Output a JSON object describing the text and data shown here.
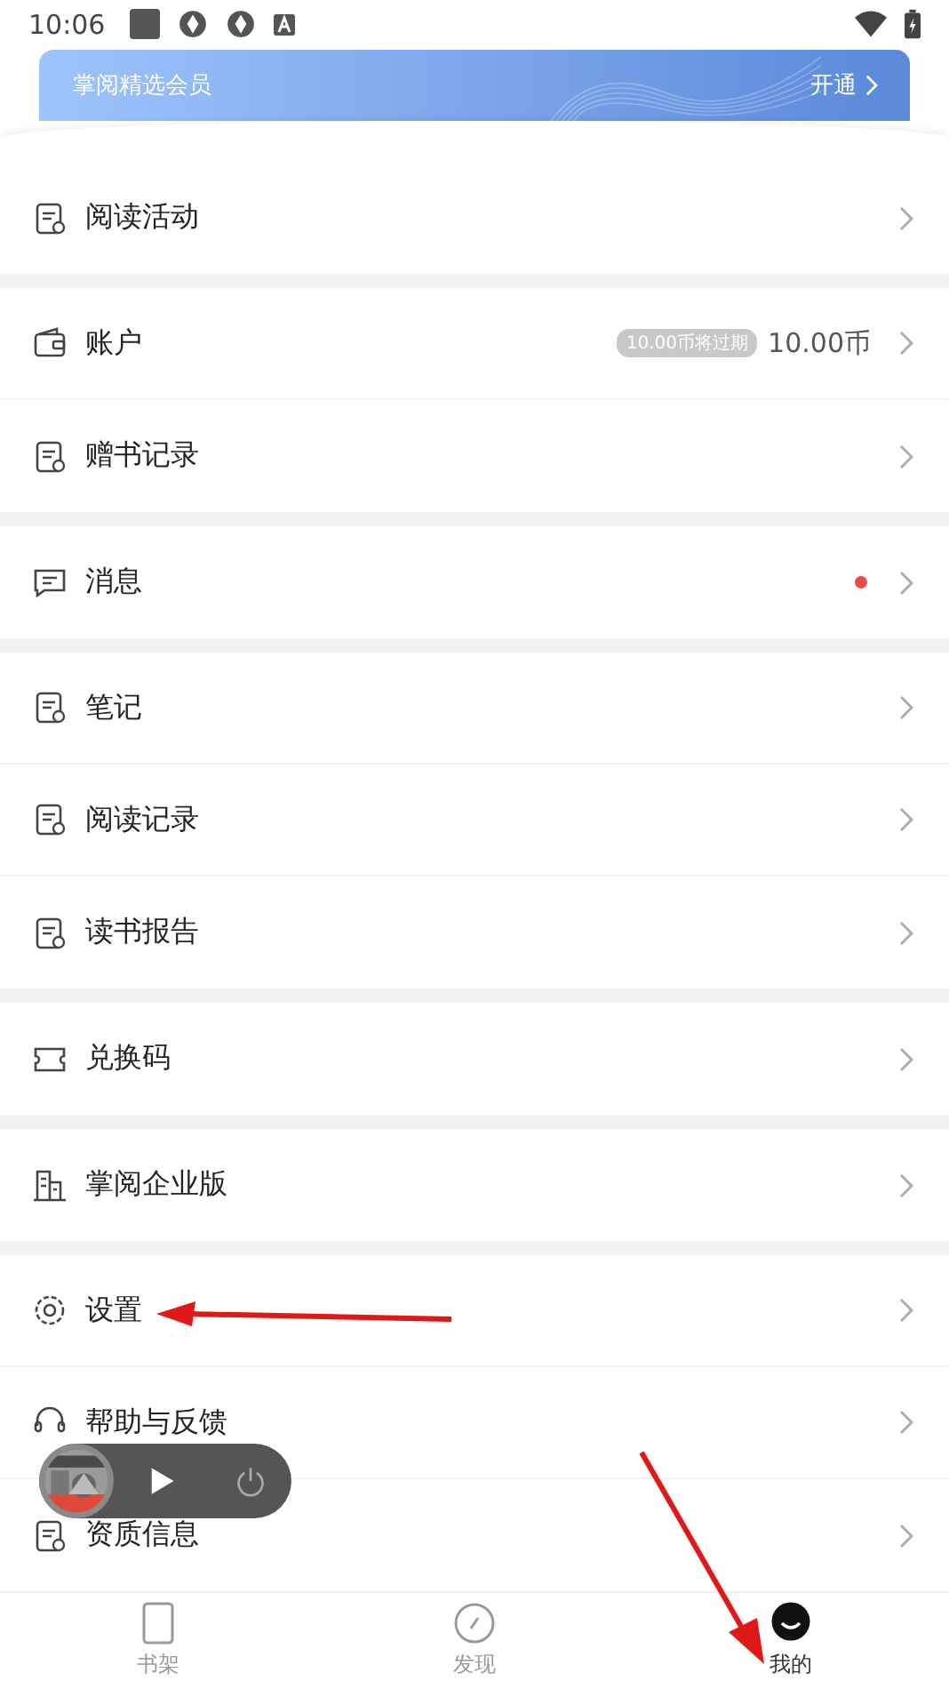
{
  "status_bar": {
    "time": "10:06"
  },
  "vip_banner": {
    "title": "掌阅精选会员",
    "action": "开通"
  },
  "sections": [
    {
      "items": [
        {
          "label": "阅读活动"
        }
      ]
    },
    {
      "items": [
        {
          "label": "账户",
          "badge": "10.00币将过期",
          "value": "10.00币"
        },
        {
          "label": "赠书记录"
        }
      ]
    },
    {
      "items": [
        {
          "label": "消息",
          "unread": true
        }
      ]
    },
    {
      "items": [
        {
          "label": "笔记"
        },
        {
          "label": "阅读记录"
        },
        {
          "label": "读书报告"
        }
      ]
    },
    {
      "items": [
        {
          "label": "兑换码"
        }
      ]
    },
    {
      "items": [
        {
          "label": "掌阅企业版"
        }
      ]
    },
    {
      "items": [
        {
          "label": "设置"
        },
        {
          "label": "帮助与反馈"
        },
        {
          "label": "资质信息"
        }
      ]
    }
  ],
  "mini_player": {
    "playing": false
  },
  "bottom_nav": [
    {
      "label": "书架",
      "selected": false
    },
    {
      "label": "发现",
      "selected": false
    },
    {
      "label": "我的",
      "selected": true
    }
  ]
}
